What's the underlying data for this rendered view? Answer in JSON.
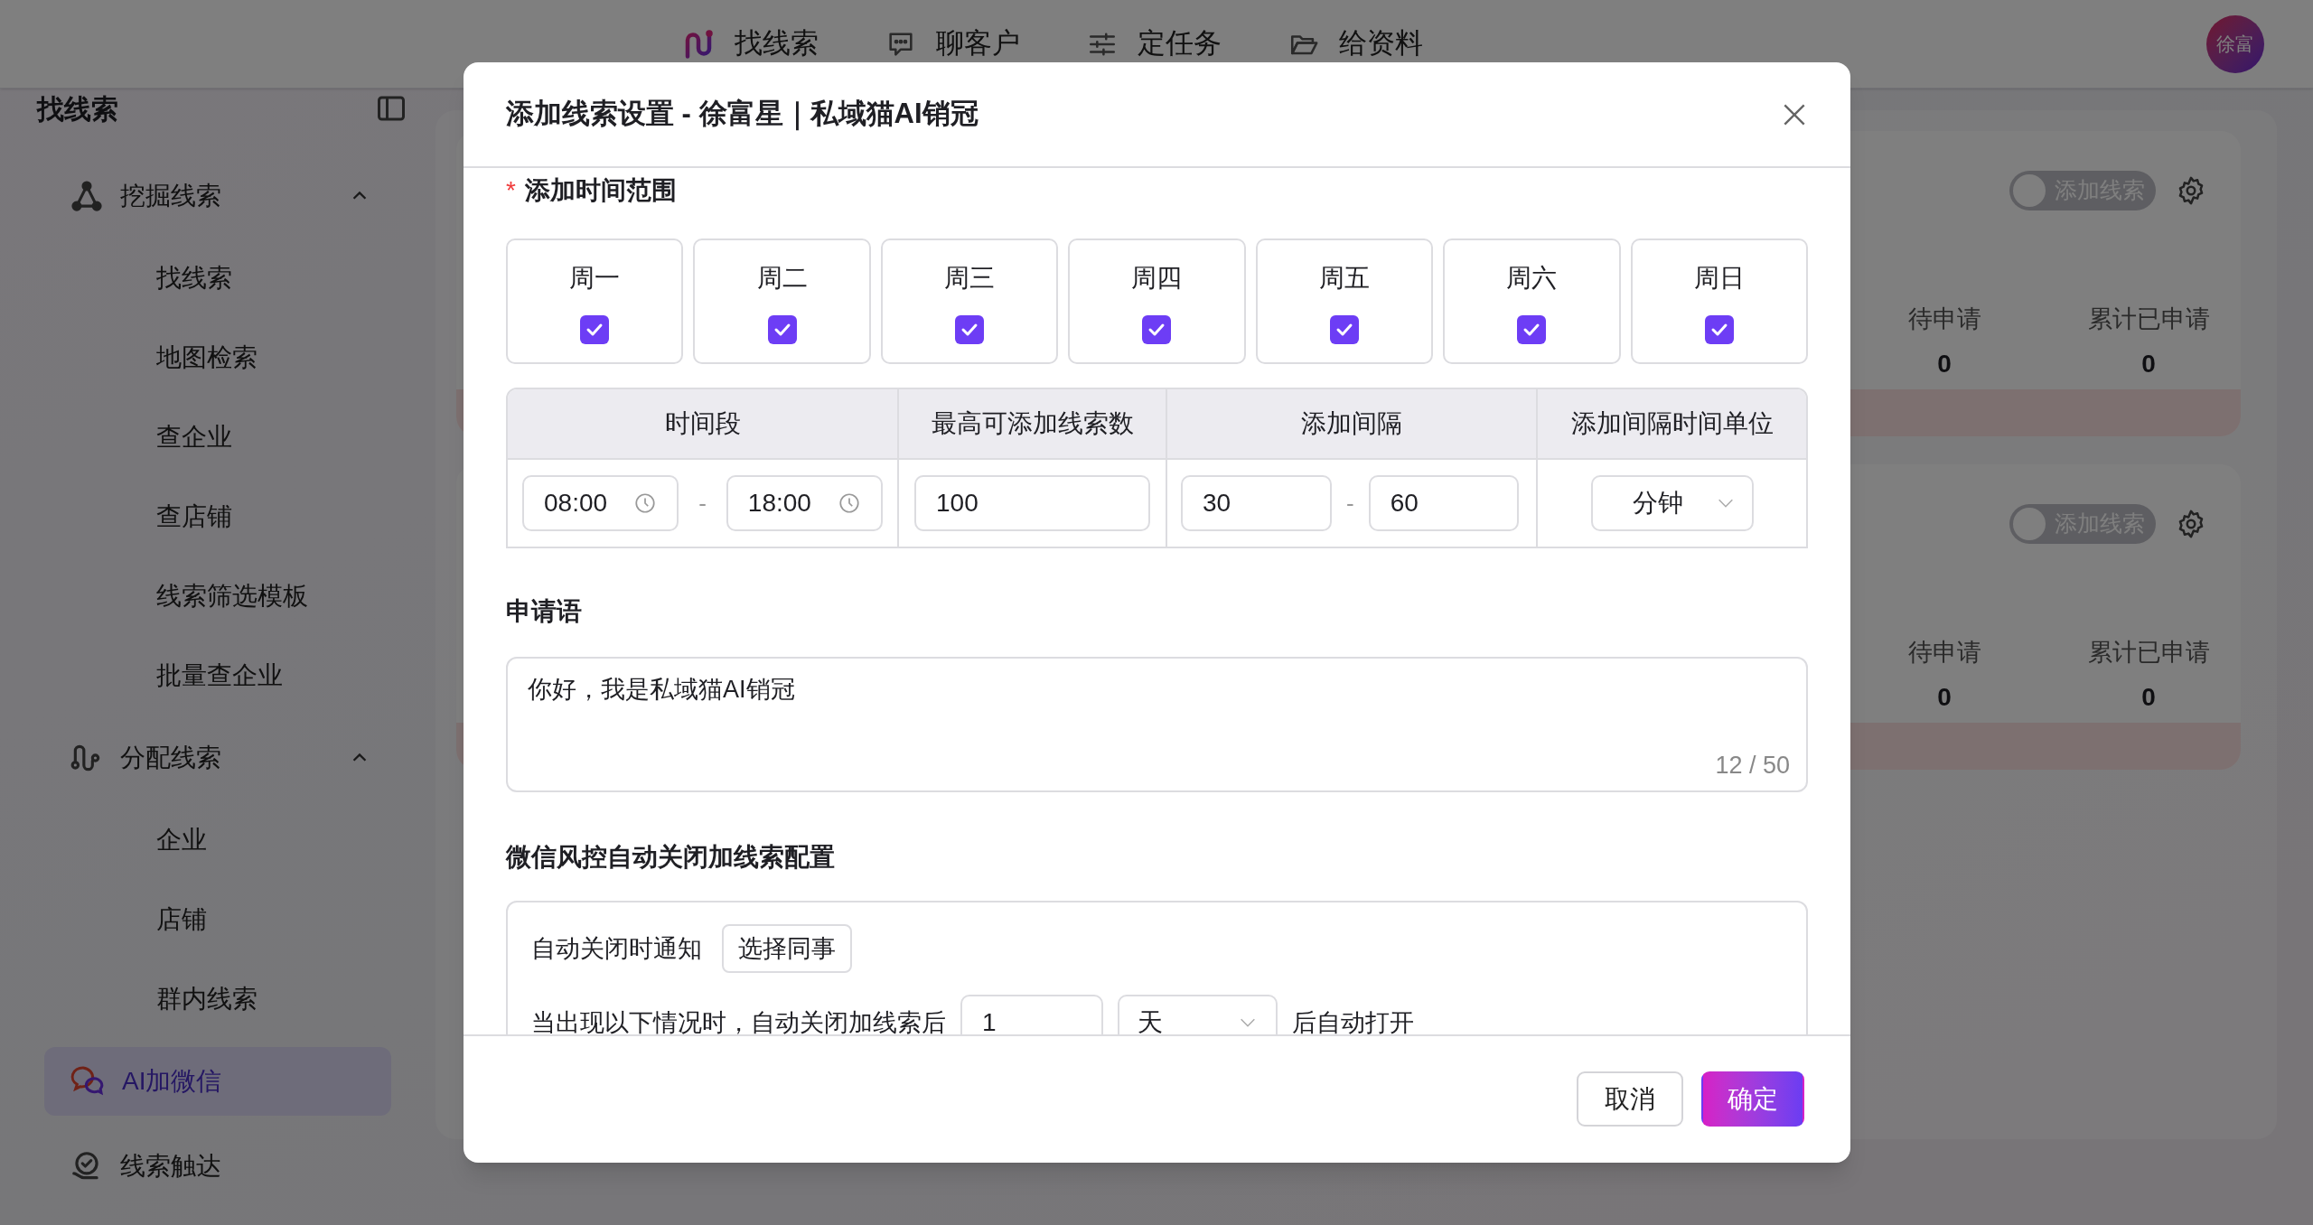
{
  "top_nav": {
    "items": [
      {
        "label": "找线索",
        "selected": false
      },
      {
        "label": "聊客户",
        "selected": false
      },
      {
        "label": "定任务",
        "selected": false
      },
      {
        "label": "给资料",
        "selected": false
      }
    ],
    "avatar": "徐富"
  },
  "sidebar": {
    "title": "找线索",
    "items": [
      {
        "label": "挖掘线索",
        "expanded": true,
        "selected": false,
        "children": [
          {
            "label": "找线索",
            "selected": false
          },
          {
            "label": "地图检索",
            "selected": false
          },
          {
            "label": "查企业",
            "selected": false
          },
          {
            "label": "查店铺",
            "selected": false
          },
          {
            "label": "线索筛选模板",
            "selected": false
          },
          {
            "label": "批量查企业",
            "selected": false
          }
        ]
      },
      {
        "label": "分配线索",
        "expanded": true,
        "selected": false,
        "children": [
          {
            "label": "企业",
            "selected": false
          },
          {
            "label": "店铺",
            "selected": false
          },
          {
            "label": "群内线索",
            "selected": false
          }
        ]
      },
      {
        "label": "AI加微信",
        "selected": true
      },
      {
        "label": "线索触达",
        "selected": false
      }
    ]
  },
  "cards": [
    {
      "toggle": {
        "label": "添加线索",
        "on": false
      },
      "stats": [
        {
          "label": "待申请",
          "value": "0"
        },
        {
          "label": "累计已申请",
          "value": "0"
        }
      ]
    },
    {
      "toggle": {
        "label": "添加线索",
        "on": false
      },
      "stats": [
        {
          "label": "待申请",
          "value": "0"
        },
        {
          "label": "累计已申请",
          "value": "0"
        }
      ]
    }
  ],
  "modal": {
    "title": "添加线索设置 - 徐富星｜私域猫AI销冠",
    "time_range": {
      "required_mark": "*",
      "label": "添加时间范围",
      "days": [
        {
          "label": "周一",
          "checked": true
        },
        {
          "label": "周二",
          "checked": true
        },
        {
          "label": "周三",
          "checked": true
        },
        {
          "label": "周四",
          "checked": true
        },
        {
          "label": "周五",
          "checked": true
        },
        {
          "label": "周六",
          "checked": true
        },
        {
          "label": "周日",
          "checked": true
        }
      ]
    },
    "schedule": {
      "columns": [
        "时间段",
        "最高可添加线索数",
        "添加间隔",
        "添加间隔时间单位"
      ],
      "time_start": "08:00",
      "time_separator": "-",
      "time_end": "18:00",
      "max_count": "100",
      "interval_min": "30",
      "interval_separator": "-",
      "interval_max": "60",
      "unit": "分钟"
    },
    "greeting": {
      "label": "申请语",
      "value": "你好，我是私域猫AI销冠",
      "counter": "12 / 50"
    },
    "risk": {
      "label": "微信风控自动关闭加线索配置",
      "notify_label": "自动关闭时通知",
      "notify_button": "选择同事",
      "reopen_label": "当出现以下情况时，自动关闭加线索后",
      "reopen_value": "1",
      "reopen_unit": "天",
      "reopen_suffix": "后自动打开"
    },
    "buttons": [
      {
        "label": "取消",
        "kind": "default"
      },
      {
        "label": "确定",
        "kind": "primary"
      }
    ]
  }
}
